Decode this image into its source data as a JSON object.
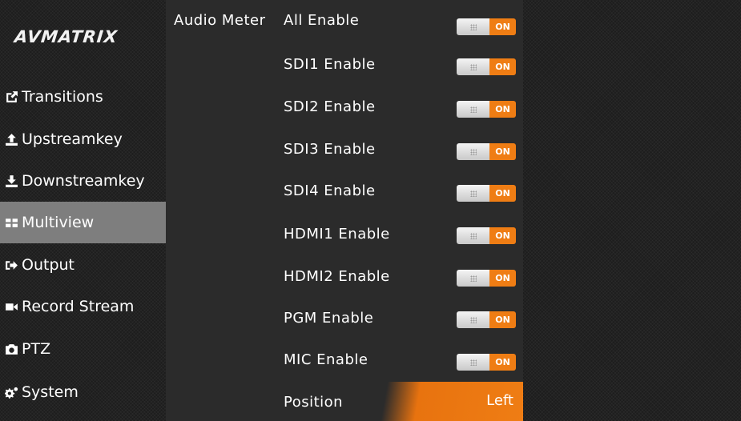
{
  "brand": {
    "logo_text": "AVMATRIX"
  },
  "sidebar": {
    "items": [
      {
        "label": "Transitions",
        "icon": "share-square-icon",
        "active": false
      },
      {
        "label": "Upstreamkey",
        "icon": "upload-icon",
        "active": false
      },
      {
        "label": "Downstreamkey",
        "icon": "download-icon",
        "active": false
      },
      {
        "label": "Multiview",
        "icon": "grid-icon",
        "active": true
      },
      {
        "label": "Output",
        "icon": "sign-out-icon",
        "active": false
      },
      {
        "label": "Record Stream",
        "icon": "video-camera-icon",
        "active": false
      },
      {
        "label": "PTZ",
        "icon": "camera-icon",
        "active": false
      },
      {
        "label": "System",
        "icon": "gears-icon",
        "active": false
      }
    ]
  },
  "panel": {
    "section_label": "Audio Meter",
    "rows": [
      {
        "label": "All Enable",
        "state": "ON"
      },
      {
        "label": "SDI1 Enable",
        "state": "ON"
      },
      {
        "label": "SDI2 Enable",
        "state": "ON"
      },
      {
        "label": "SDI3 Enable",
        "state": "ON"
      },
      {
        "label": "SDI4 Enable",
        "state": "ON"
      },
      {
        "label": "HDMI1 Enable",
        "state": "ON"
      },
      {
        "label": "HDMI2 Enable",
        "state": "ON"
      },
      {
        "label": "PGM Enable",
        "state": "ON"
      },
      {
        "label": "MIC Enable",
        "state": "ON"
      }
    ],
    "position": {
      "label": "Position",
      "value": "Left"
    }
  },
  "colors": {
    "accent": "#ef7d14",
    "panel_bg": "#2b2b2b",
    "active_item_bg": "#7e7e7e"
  }
}
